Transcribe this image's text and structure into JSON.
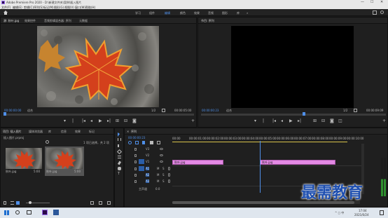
{
  "window": {
    "title": "Adobe Premiere Pro 2020 - D:\\新建文件夹\\案例\\插入图片",
    "controls": [
      "—",
      "☐",
      "✕"
    ]
  },
  "menu": [
    "文件(F)",
    "编辑(E)",
    "剪辑(C)",
    "序列(S)",
    "标记(M)",
    "图形(G)",
    "视图(V)",
    "窗口(W)",
    "帮助(H)"
  ],
  "workspaces": {
    "items": [
      "学习",
      "组件",
      "编辑",
      "颜色",
      "效果",
      "音频",
      "图形",
      "库"
    ],
    "active_index": 2,
    "more": "»"
  },
  "source_monitor": {
    "tabs": [
      "源: 秋叶.jpg",
      "效果控件",
      "音频剪辑混合器: 序列",
      "元数据"
    ],
    "timecode_left": "00:00:00:00",
    "fit": "适合",
    "fraction": "1/2",
    "timecode_right": "00:00:05:00"
  },
  "program_monitor": {
    "title": "节目: 序列",
    "timecode_left": "00:00:00:23",
    "fit": "适合",
    "fraction": "1/2",
    "timecode_right": "00:00:09:09"
  },
  "project_panel": {
    "tabs": [
      "项目: 插入图片",
      "媒体浏览器",
      "库",
      "信息",
      "效果",
      "标记"
    ],
    "project_file": "插入图片.prproj",
    "selection_info": "1 项已选择，共 2 项",
    "items": [
      {
        "name": "秋叶.jpg",
        "duration": "5:00"
      },
      {
        "name": "秋叶.jpg",
        "duration": "5:00"
      }
    ]
  },
  "timeline": {
    "title": "序列",
    "timecode": "00:00:00:23",
    "ruler": [
      "00:00",
      "00:00:01:00",
      "00:00:02:00",
      "00:00:03:00",
      "00:00:04:00",
      "00:00:05:00",
      "00:00:06:00",
      "00:00:07:00",
      "00:00:08:00",
      "00:00:09:00",
      "00:00:10:00"
    ],
    "video_tracks": [
      "V3",
      "V2",
      "V1"
    ],
    "audio_tracks": [
      "A1",
      "A2",
      "A3"
    ],
    "master": "主声道",
    "master_value": "0.0",
    "clips": [
      {
        "label": "秋叶.jpg",
        "start_sec": 0.0,
        "end_sec": 2.9
      },
      {
        "label": "秋叶.jpg",
        "start_sec": 5.0,
        "end_sec": 9.3
      }
    ],
    "playhead_sec": 5.0
  },
  "watermark": "最需教育",
  "taskbar": {
    "time": "17:04",
    "date": "2021/6/24",
    "lang": "中",
    "indicators": "^ ◻ 中"
  }
}
